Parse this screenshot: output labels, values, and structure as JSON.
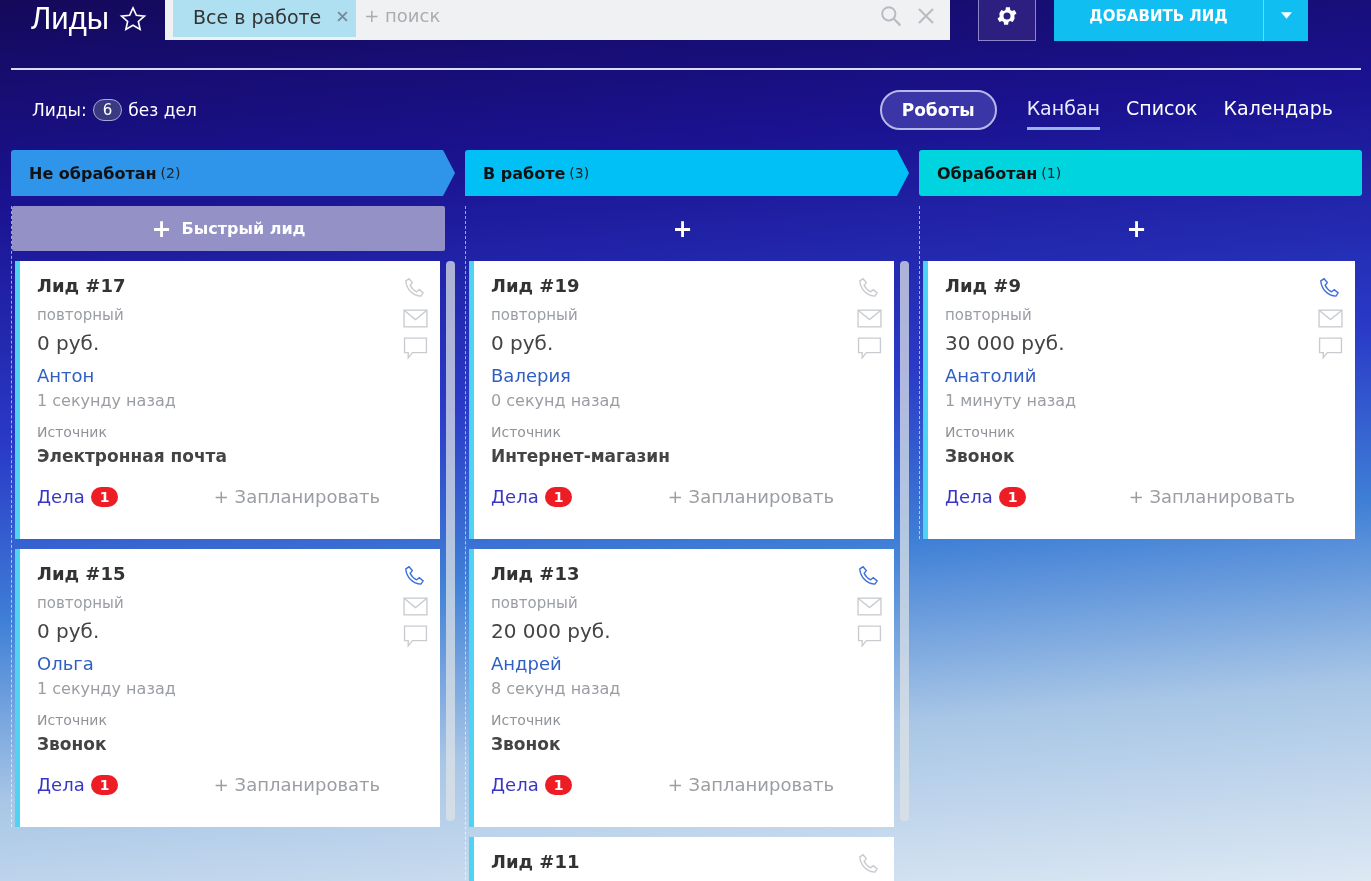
{
  "header": {
    "title": "Лиды",
    "filter_chip": "Все в работе",
    "search": {
      "placeholder": "+ поиск"
    },
    "add_button": "ДОБАВИТЬ ЛИД"
  },
  "summary": {
    "label": "Лиды:",
    "count": "6",
    "suffix": "без дел"
  },
  "robots_button": "Роботы",
  "views": [
    {
      "label": "Канбан",
      "selected": true
    },
    {
      "label": "Список",
      "selected": false
    },
    {
      "label": "Календарь",
      "selected": false
    }
  ],
  "columns": [
    {
      "name": "Не обработан",
      "count": "(2)",
      "color": "#2e95ea",
      "add": {
        "kind": "quick",
        "icon": "+",
        "label": "Быстрый лид"
      },
      "cards": [
        {
          "title": "Лид #17",
          "type": "повторный",
          "amount": "0 руб.",
          "contact": "Антон",
          "time": "1 секунду назад",
          "source_label": "Источник",
          "source": "Электронная почта",
          "tasks_label": "Дела",
          "tasks_count": "1",
          "plan": "+ Запланировать",
          "phone_active": false
        },
        {
          "title": "Лид #15",
          "type": "повторный",
          "amount": "0 руб.",
          "contact": "Ольга",
          "time": "1 секунду назад",
          "source_label": "Источник",
          "source": "Звонок",
          "tasks_label": "Дела",
          "tasks_count": "1",
          "plan": "+ Запланировать",
          "phone_active": true
        }
      ]
    },
    {
      "name": "В работе",
      "count": "(3)",
      "color": "#00c0f5",
      "add": {
        "kind": "plain",
        "icon": "+"
      },
      "cards": [
        {
          "title": "Лид #19",
          "type": "повторный",
          "amount": "0 руб.",
          "contact": "Валерия",
          "time": "0 секунд назад",
          "source_label": "Источник",
          "source": "Интернет-магазин",
          "tasks_label": "Дела",
          "tasks_count": "1",
          "plan": "+ Запланировать",
          "phone_active": false
        },
        {
          "title": "Лид #13",
          "type": "повторный",
          "amount": "20 000 руб.",
          "contact": "Андрей",
          "time": "8 секунд назад",
          "source_label": "Источник",
          "source": "Звонок",
          "tasks_label": "Дела",
          "tasks_count": "1",
          "plan": "+ Запланировать",
          "phone_active": true
        },
        {
          "title": "Лид #11",
          "phone_active": false
        }
      ]
    },
    {
      "name": "Обработан",
      "count": "(1)",
      "color": "#00d4de",
      "add": {
        "kind": "plain",
        "icon": "+"
      },
      "cards": [
        {
          "title": "Лид #9",
          "type": "повторный",
          "amount": "30 000 руб.",
          "contact": "Анатолий",
          "time": "1 минуту назад",
          "source_label": "Источник",
          "source": "Звонок",
          "tasks_label": "Дела",
          "tasks_count": "1",
          "plan": "+ Запланировать",
          "phone_active": true
        }
      ]
    }
  ]
}
